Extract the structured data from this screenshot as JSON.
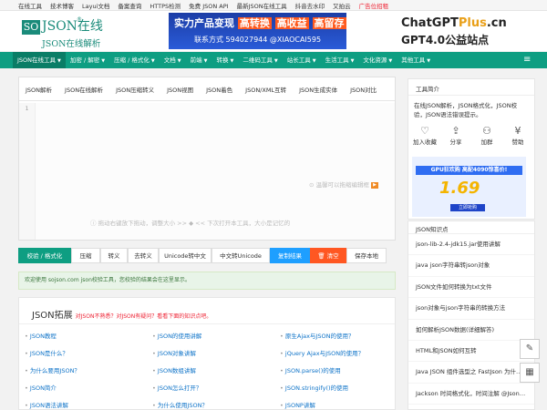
{
  "topbar": {
    "links": [
      "在线工具",
      "技术博客",
      "Layui文档",
      "备案查询",
      "HTTPS检测",
      "免费 JSON API",
      "最新JSON在线工具",
      "抖音去水印",
      "又拍云",
      "广告位招租"
    ]
  },
  "header": {
    "logo_so": "SO",
    "logo_json": "JSON在线",
    "logo_reg": "®",
    "logo_sub": "JSON在线解析",
    "banner1_text": "实力产品变现",
    "banner1_tag1": "高转换",
    "banner1_tag2": "高收益",
    "banner1_tag3": "高留存",
    "banner1_contact": "联系方式 594027944 @XIAOCAI595",
    "banner2_line1a": "ChatGPT",
    "banner2_line1b": "Plus",
    "banner2_line1c": ".cn",
    "banner2_line2": "GPT4.0公益站点"
  },
  "nav": {
    "items": [
      "JSON在线工具",
      "加密 / 解密",
      "压缩 / 格式化",
      "文档",
      "前端",
      "转换",
      "二维码工具",
      "站长工具",
      "生活工具",
      "文化资源",
      "其他工具"
    ],
    "menu_icon": "hamburger-icon"
  },
  "tabs": [
    "JSON解析",
    "JSON在线解析",
    "JSON压缩转义",
    "JSON视图",
    "JSON着色",
    "JSON/XML互转",
    "JSON生成实体",
    "JSON对比"
  ],
  "editor": {
    "line_number": "1",
    "hint_right": "温馨可以拖缩编辑框",
    "hint_bottom": "拖动右键放下拖动，调整大小 >>  ◆  << 下次打开本工具，大小是记忆的"
  },
  "buttons": [
    "校验 / 格式化",
    "压缩",
    "转义",
    "去转义",
    "Unicode转中文",
    "中文转Unicode",
    "复制结果",
    "清空",
    "保存本地"
  ],
  "result_text": "欢迎使用 sojson.com json校验工具，您校验的结果会在这里显示。",
  "extension": {
    "title": "JSON拓展",
    "subtitle": "对JSON不熟悉？对JSON有疑问？看看下面的知识点吧。",
    "links": [
      "JSON教程",
      "JSON的使用讲解",
      "原生Ajax与JSON的使用？",
      "JSON是什么？",
      "JSON对象讲解",
      "jQuery Ajax与JSON的使用？",
      "为什么要用JSON？",
      "JSON数组讲解",
      "JSON.parse()的使用",
      "JSON简介",
      "JSON怎么打开？",
      "JSON.stringify()的使用",
      "JSON语法讲解",
      "为什么使用JSON？",
      "JSONP讲解"
    ]
  },
  "sidebar": {
    "intro_title": "工具简介",
    "intro_desc": "在线JSON解析，JSON格式化，JSON校验，JSON语法错误提示。",
    "actions": [
      {
        "label": "加入收藏",
        "icon": "heart-icon"
      },
      {
        "label": "分享",
        "icon": "share-icon"
      },
      {
        "label": "加群",
        "icon": "group-icon"
      },
      {
        "label": "赞助",
        "icon": "money-icon"
      }
    ],
    "ad_title": "GPU狂欢购 高配4090惊喜价!",
    "ad_price": "1.69",
    "ad_button": "立即抢购",
    "knowledge_title": "JSON知识点",
    "knowledge": [
      "json-lib-2.4-jdk15.jar使用讲解",
      "java json字符串转json对象",
      "JSON文件如何转换为txt文件",
      "json对象与json字符串的转换方法",
      "如何解析JSON数据(详细解答)",
      "HTML和JSON如何互转",
      "Java JSON 组件选型之 FastJson 为什…",
      "Jackson 时间格式化，时间注解 @Json…"
    ]
  },
  "float": {
    "icons": [
      "edit-icon",
      "qr-icon"
    ]
  }
}
